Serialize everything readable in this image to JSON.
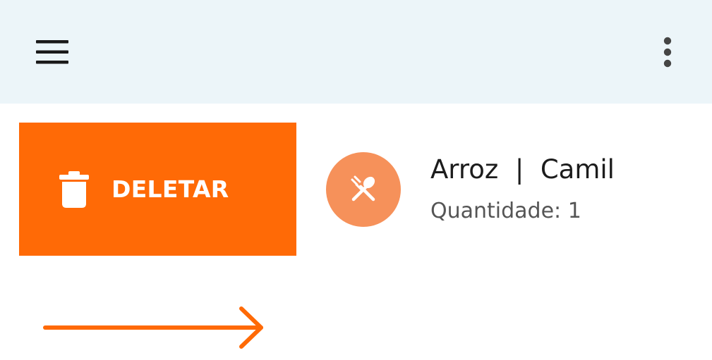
{
  "toolbar": {
    "menu_icon": "hamburger-menu-icon",
    "overflow_icon": "more-vert-icon",
    "background": "#ecf5f9"
  },
  "swipe_action": {
    "label": "DELETAR",
    "icon": "trash-icon",
    "background": "#ff6a06"
  },
  "item": {
    "title": "Arroz  |  Camil",
    "subtitle": "Quantidade: 1",
    "avatar_icon": "cutlery-icon",
    "avatar_color": "#f6915a"
  },
  "hint": {
    "icon": "arrow-right-icon",
    "color": "#ff6a06"
  }
}
